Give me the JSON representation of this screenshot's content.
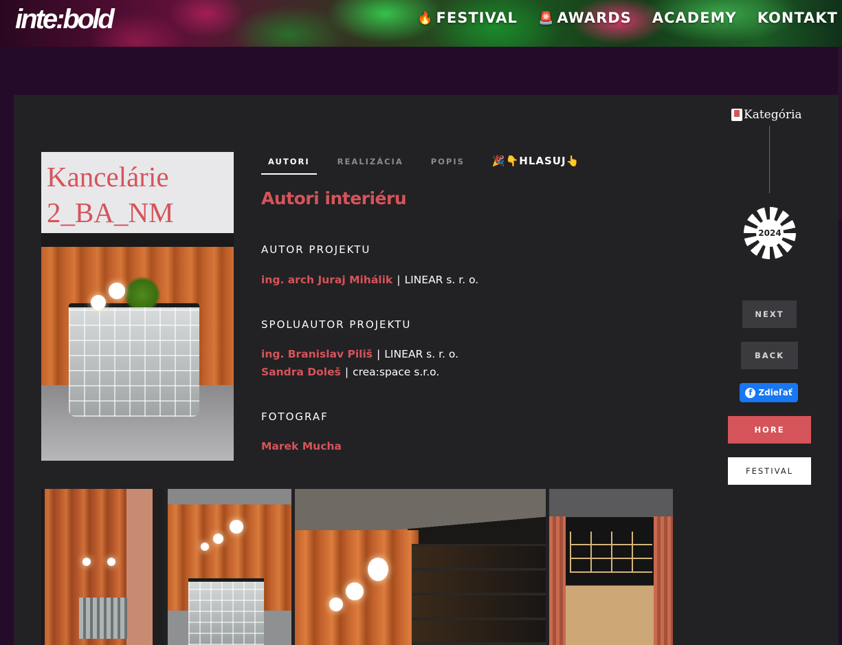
{
  "header": {
    "logo": "inte:bold",
    "nav": [
      {
        "icon": "🔥",
        "label": "FESTIVAL"
      },
      {
        "icon": "🚨",
        "label": "AWARDS"
      },
      {
        "icon": "",
        "label": "ACADEMY"
      },
      {
        "icon": "",
        "label": "KONTAKT"
      }
    ]
  },
  "cover": {
    "title": "Kancelárie 2_BA_NM"
  },
  "tabs": [
    {
      "label": "AUTORI",
      "active": true
    },
    {
      "label": "REALIZÁCIA",
      "active": false
    },
    {
      "label": "POPIS",
      "active": false
    },
    {
      "label": "🎉👇HLASUJ👆",
      "active": false
    }
  ],
  "content": {
    "section_title": "Autori interiéru",
    "author_role": "AUTOR PROJEKTU",
    "authors": [
      {
        "name": "ing. arch Juraj Mihálik",
        "company": "LINEAR s. r. o."
      }
    ],
    "coauthor_role": "SPOLUAUTOR PROJEKTU",
    "coauthors": [
      {
        "name": "ing. Branislav Piliš",
        "company": "LINEAR s. r. o."
      },
      {
        "name": "Sandra Doleš",
        "company": "crea:space s.r.o."
      }
    ],
    "photographer_role": "FOTOGRAF",
    "photographer": "Marek Mucha",
    "separator": "|"
  },
  "sidebar": {
    "category_label": "Kategória",
    "badge_year": "2024",
    "next": "NEXT",
    "back": "BACK",
    "share": "Zdieľať",
    "top": "HORE",
    "festival": "FESTIVAL"
  },
  "colors": {
    "accent": "#d5545a",
    "panel": "#222124",
    "background": "#250b2a",
    "facebook": "#1877f2"
  }
}
